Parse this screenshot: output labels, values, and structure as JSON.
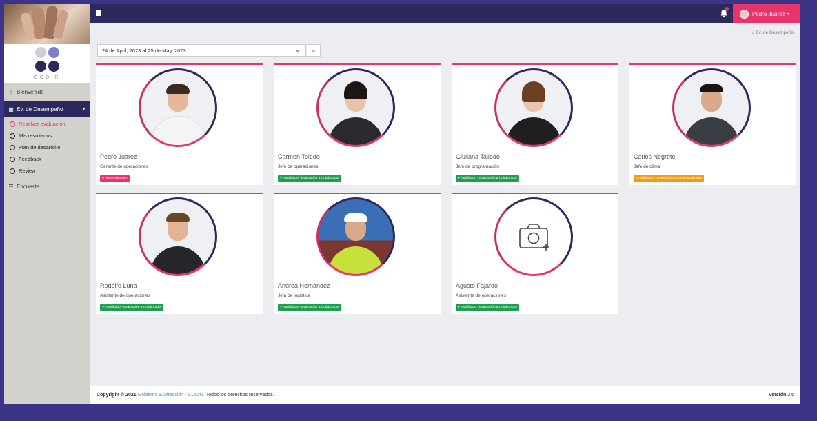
{
  "sidebar": {
    "logo_text": "CODIR",
    "items": [
      {
        "label": "Bienvenido",
        "icon": "home-icon"
      },
      {
        "label": "Ev. de Desempeño",
        "icon": "table-icon"
      },
      {
        "label": "Encuesta",
        "icon": "list-icon"
      }
    ],
    "sub_items": [
      {
        "label": "Resolver evaluación"
      },
      {
        "label": "Mis resultados"
      },
      {
        "label": "Plan de desarrollo"
      },
      {
        "label": "Feedback"
      },
      {
        "label": "Review"
      }
    ],
    "colors": {
      "logo_dots": [
        "#cfcfd6",
        "#7f7fc7",
        "#2c2a5c",
        "#2c2a5c"
      ]
    }
  },
  "topbar": {
    "user_label": "Pedro Juarez",
    "notification_count": "1",
    "accent": "#e8336d",
    "nav_bg": "#2c2a5c"
  },
  "breadcrumb": "Ev. de Desempeño",
  "filter": {
    "date_range": "24 de April, 2023 al 25 de May, 2023"
  },
  "cards": [
    {
      "name": "Pedro Juarez",
      "role": "Gerente de operaciones",
      "tag": "Autoevaluación",
      "tag_color": "red"
    },
    {
      "name": "Carmen Toledo",
      "role": "Jefe de operaciones",
      "tag": "Habilitado - Evaluación a Colaborador",
      "tag_color": "green"
    },
    {
      "name": "Giuliana Talledo",
      "role": "Jefe de programación",
      "tag": "Habilitado - Evaluación a Colaborador",
      "tag_color": "green"
    },
    {
      "name": "Carlos Negrete",
      "role": "Jefe de clima",
      "tag": "Habilitado - Evaluación como Subordinado",
      "tag_color": "orange"
    },
    {
      "name": "Rodolfo Luna",
      "role": "Asistente de operaciones",
      "tag": "Habilitado - Evaluación a Colaborador",
      "tag_color": "green"
    },
    {
      "name": "Andrea Hernandez",
      "role": "Jefa de logística",
      "tag": "Habilitado - Evaluación a Colaborador",
      "tag_color": "green"
    },
    {
      "name": "Agusto Fajardo",
      "role": "Asistente de operaciones",
      "tag": "Habilitado - Evaluación a Colaborador",
      "tag_color": "green"
    }
  ],
  "footer": {
    "copyright": "Copyright © 2021",
    "link": "Gobierno & Dirección - CODIR.",
    "rights": "Todos los derechos reservados.",
    "version_label": "Versión",
    "version": "3.6"
  }
}
